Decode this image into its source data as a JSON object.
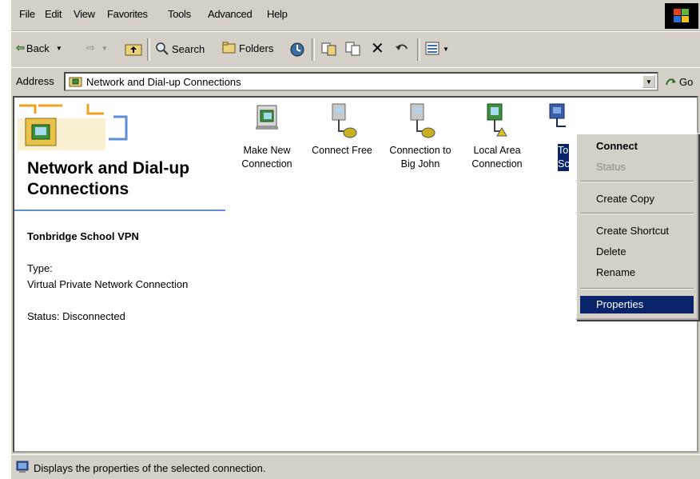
{
  "menu": {
    "items": [
      "File",
      "Edit",
      "View",
      "Favorites",
      "Tools",
      "Advanced",
      "Help"
    ]
  },
  "toolbar": {
    "back_label": "Back",
    "search_label": "Search",
    "folders_label": "Folders"
  },
  "address": {
    "label": "Address",
    "value": "Network and Dial-up Connections",
    "go_label": "Go"
  },
  "webview": {
    "title": "Network and Dial-up Connections",
    "selected_name": "Tonbridge School VPN",
    "type_label": "Type:",
    "type_value": "Virtual Private Network Connection",
    "status": "Status: Disconnected"
  },
  "connections": [
    {
      "line1": "Make New",
      "line2": "Connection",
      "icon": "make-new-connection-icon"
    },
    {
      "line1": "Connect Free",
      "line2": "",
      "icon": "dialup-connection-icon"
    },
    {
      "line1": "Connection to",
      "line2": "Big John",
      "icon": "dialup-connection-icon"
    },
    {
      "line1": "Local Area",
      "line2": "Connection",
      "icon": "lan-connection-icon"
    },
    {
      "line1": "To",
      "line2": "Sch",
      "icon": "vpn-connection-icon",
      "selected": true
    }
  ],
  "context_menu": {
    "connect": "Connect",
    "status": "Status",
    "create_copy": "Create Copy",
    "create_shortcut": "Create Shortcut",
    "delete": "Delete",
    "rename": "Rename",
    "properties": "Properties"
  },
  "statusbar": {
    "text": "Displays the properties of the selected connection."
  },
  "colors": {
    "chrome": "#d4d0c8",
    "highlight": "#0a246a",
    "accent_rule": "#5b8fd6"
  }
}
